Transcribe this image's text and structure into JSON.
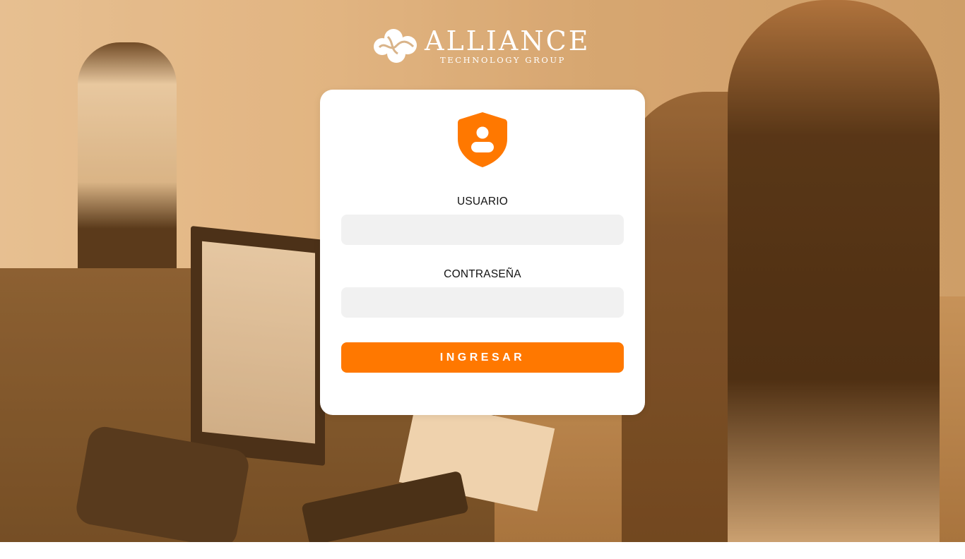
{
  "brand": {
    "name": "ALLIANCE",
    "tagline": "TECHNOLOGY GROUP",
    "logo_icon": "cloud-swirl-logo-icon"
  },
  "login": {
    "icon": "user-shield-icon",
    "username_label": "USUARIO",
    "username_value": "",
    "password_label": "CONTRASEÑA",
    "password_value": "",
    "submit_label": "INGRESAR"
  },
  "colors": {
    "accent": "#ff7800",
    "input_bg": "#f1f1f1",
    "card_bg": "#ffffff",
    "background_tint": "#c99a66"
  }
}
